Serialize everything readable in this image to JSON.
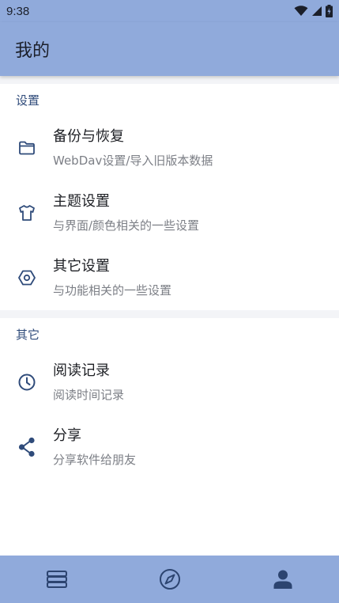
{
  "status_bar": {
    "time": "9:38"
  },
  "app_bar": {
    "title": "我的"
  },
  "sections": [
    {
      "header": "设置",
      "items": [
        {
          "icon": "folder-icon",
          "title": "备份与恢复",
          "subtitle": "WebDav设置/导入旧版本数据"
        },
        {
          "icon": "tshirt-icon",
          "title": "主题设置",
          "subtitle": "与界面/颜色相关的一些设置"
        },
        {
          "icon": "hex-nut-icon",
          "title": "其它设置",
          "subtitle": "与功能相关的一些设置"
        }
      ]
    },
    {
      "header": "其它",
      "items": [
        {
          "icon": "clock-icon",
          "title": "阅读记录",
          "subtitle": "阅读时间记录"
        },
        {
          "icon": "share-icon",
          "title": "分享",
          "subtitle": "分享软件给朋友"
        }
      ]
    }
  ],
  "bottom_nav": [
    {
      "icon": "bookshelf-icon",
      "selected": false
    },
    {
      "icon": "compass-icon",
      "selected": false
    },
    {
      "icon": "person-icon",
      "selected": true
    }
  ],
  "colors": {
    "primary": "#90aadb",
    "icon": "#2f4b7a",
    "nav_icon": "#2c4470"
  }
}
